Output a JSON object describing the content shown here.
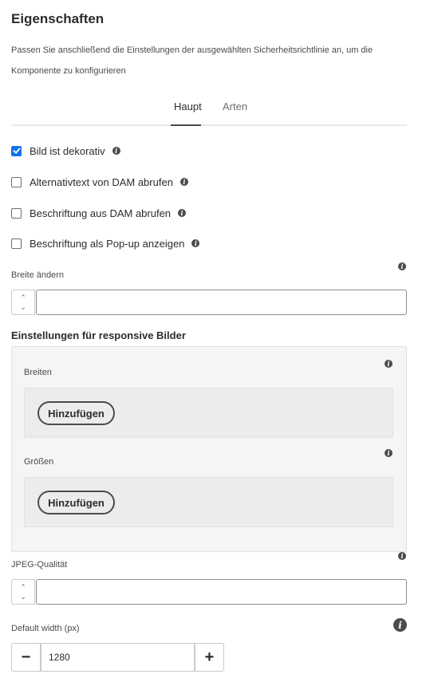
{
  "header": {
    "title": "Eigenschaften",
    "description": "Passen Sie anschließend die Einstellungen der ausgewählten Sicherheitsrichtlinie an, um die Komponente zu konfigurieren"
  },
  "tabs": [
    {
      "label": "Haupt",
      "active": true
    },
    {
      "label": "Arten",
      "active": false
    }
  ],
  "checkboxes": [
    {
      "label": "Bild ist dekorativ",
      "checked": true
    },
    {
      "label": "Alternativtext von DAM abrufen",
      "checked": false
    },
    {
      "label": "Beschriftung aus DAM abrufen",
      "checked": false
    },
    {
      "label": "Beschriftung als Pop-up anzeigen",
      "checked": false
    }
  ],
  "resize_width": {
    "label": "Breite ändern",
    "value": ""
  },
  "responsive": {
    "title": "Einstellungen für responsive Bilder",
    "widths_label": "Breiten",
    "sizes_label": "Größen",
    "add_label": "Hinzufügen"
  },
  "jpeg_quality": {
    "label": "JPEG-Qualität",
    "value": ""
  },
  "default_width": {
    "label": "Default width (px)",
    "value": "1280",
    "minus": "−",
    "plus": "+"
  },
  "icons": {
    "info": "info-icon",
    "check": "checkmark-icon",
    "stepper": "chevron-up-down-icon"
  },
  "colors": {
    "accent": "#1473e6",
    "text": "#2c2c2c",
    "muted": "#6e6e6e",
    "panel": "#f5f5f5"
  }
}
